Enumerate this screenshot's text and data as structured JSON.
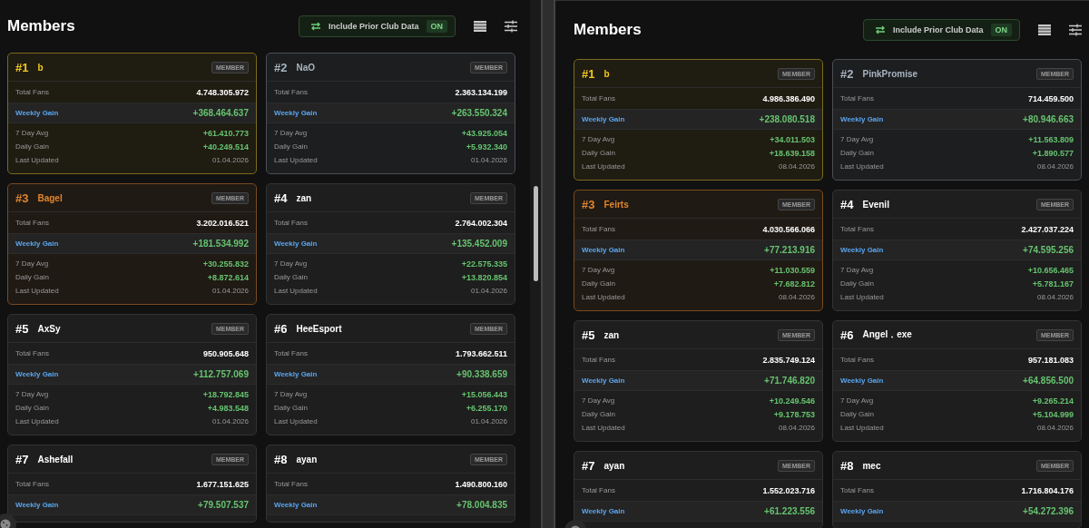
{
  "panes": [
    {
      "title": "Members",
      "toggle": {
        "label": "Include Prior Club Data",
        "state": "ON",
        "on": true
      },
      "cards": [
        {
          "rank": "#1",
          "name": "b",
          "kind": "gold",
          "badge": "MEMBER",
          "stats": [
            {
              "kind": "total",
              "label": "Total Fans",
              "value": "4.748.305.972"
            },
            {
              "kind": "weekly",
              "label": "Weekly Gain",
              "value": "+368.464.637"
            },
            {
              "kind": "gain",
              "label": "7 Day Avg",
              "value": "+61.410.773"
            },
            {
              "kind": "gain",
              "label": "Daily Gain",
              "value": "+40.249.514"
            },
            {
              "kind": "date",
              "label": "Last Updated",
              "value": "01.04.2026"
            }
          ]
        },
        {
          "rank": "#2",
          "name": "NaO",
          "kind": "silver",
          "badge": "MEMBER",
          "stats": [
            {
              "kind": "total",
              "label": "Total Fans",
              "value": "2.363.134.199"
            },
            {
              "kind": "weekly",
              "label": "Weekly Gain",
              "value": "+263.550.324"
            },
            {
              "kind": "gain",
              "label": "7 Day Avg",
              "value": "+43.925.054"
            },
            {
              "kind": "gain",
              "label": "Daily Gain",
              "value": "+5.932.340"
            },
            {
              "kind": "date",
              "label": "Last Updated",
              "value": "01.04.2026"
            }
          ]
        },
        {
          "rank": "#3",
          "name": "Bagel",
          "kind": "bronze",
          "badge": "MEMBER",
          "stats": [
            {
              "kind": "total",
              "label": "Total Fans",
              "value": "3.202.016.521"
            },
            {
              "kind": "weekly",
              "label": "Weekly Gain",
              "value": "+181.534.992"
            },
            {
              "kind": "gain",
              "label": "7 Day Avg",
              "value": "+30.255.832"
            },
            {
              "kind": "gain",
              "label": "Daily Gain",
              "value": "+8.872.614"
            },
            {
              "kind": "date",
              "label": "Last Updated",
              "value": "01.04.2026"
            }
          ]
        },
        {
          "rank": "#4",
          "name": "zan",
          "kind": "plain",
          "badge": "MEMBER",
          "stats": [
            {
              "kind": "total",
              "label": "Total Fans",
              "value": "2.764.002.304"
            },
            {
              "kind": "weekly",
              "label": "Weekly Gain",
              "value": "+135.452.009"
            },
            {
              "kind": "gain",
              "label": "7 Day Avg",
              "value": "+22.575.335"
            },
            {
              "kind": "gain",
              "label": "Daily Gain",
              "value": "+13.820.854"
            },
            {
              "kind": "date",
              "label": "Last Updated",
              "value": "01.04.2026"
            }
          ]
        },
        {
          "rank": "#5",
          "name": "AxSy",
          "kind": "plain",
          "badge": "MEMBER",
          "stats": [
            {
              "kind": "total",
              "label": "Total Fans",
              "value": "950.905.648"
            },
            {
              "kind": "weekly",
              "label": "Weekly Gain",
              "value": "+112.757.069"
            },
            {
              "kind": "gain",
              "label": "7 Day Avg",
              "value": "+18.792.845"
            },
            {
              "kind": "gain",
              "label": "Daily Gain",
              "value": "+4.983.548"
            },
            {
              "kind": "date",
              "label": "Last Updated",
              "value": "01.04.2026"
            }
          ]
        },
        {
          "rank": "#6",
          "name": "HeeEsport",
          "kind": "plain",
          "badge": "MEMBER",
          "stats": [
            {
              "kind": "total",
              "label": "Total Fans",
              "value": "1.793.662.511"
            },
            {
              "kind": "weekly",
              "label": "Weekly Gain",
              "value": "+90.338.659"
            },
            {
              "kind": "gain",
              "label": "7 Day Avg",
              "value": "+15.056.443"
            },
            {
              "kind": "gain",
              "label": "Daily Gain",
              "value": "+6.255.170"
            },
            {
              "kind": "date",
              "label": "Last Updated",
              "value": "01.04.2026"
            }
          ]
        },
        {
          "rank": "#7",
          "name": "Ashefall",
          "kind": "plain",
          "badge": "MEMBER",
          "stats": [
            {
              "kind": "total",
              "label": "Total Fans",
              "value": "1.677.151.625"
            },
            {
              "kind": "weekly",
              "label": "Weekly Gain",
              "value": "+79.507.537"
            }
          ]
        },
        {
          "rank": "#8",
          "name": "ayan",
          "kind": "plain",
          "badge": "MEMBER",
          "stats": [
            {
              "kind": "total",
              "label": "Total Fans",
              "value": "1.490.800.160"
            },
            {
              "kind": "weekly",
              "label": "Weekly Gain",
              "value": "+78.004.835"
            }
          ]
        }
      ]
    },
    {
      "title": "Members",
      "toggle": {
        "label": "Include Prior Club Data",
        "state": "ON",
        "on": true
      },
      "cards": [
        {
          "rank": "#1",
          "name": "b",
          "kind": "gold",
          "badge": "MEMBER",
          "stats": [
            {
              "kind": "total",
              "label": "Total Fans",
              "value": "4.986.386.490"
            },
            {
              "kind": "weekly",
              "label": "Weekly Gain",
              "value": "+238.080.518"
            },
            {
              "kind": "gain",
              "label": "7 Day Avg",
              "value": "+34.011.503"
            },
            {
              "kind": "gain",
              "label": "Daily Gain",
              "value": "+18.639.158"
            },
            {
              "kind": "date",
              "label": "Last Updated",
              "value": "08.04.2026"
            }
          ]
        },
        {
          "rank": "#2",
          "name": "PinkPromise",
          "kind": "silver",
          "badge": "MEMBER",
          "stats": [
            {
              "kind": "total",
              "label": "Total Fans",
              "value": "714.459.500"
            },
            {
              "kind": "weekly",
              "label": "Weekly Gain",
              "value": "+80.946.663"
            },
            {
              "kind": "gain",
              "label": "7 Day Avg",
              "value": "+11.563.809"
            },
            {
              "kind": "gain",
              "label": "Daily Gain",
              "value": "+1.890.577"
            },
            {
              "kind": "date",
              "label": "Last Updated",
              "value": "08.04.2026"
            }
          ]
        },
        {
          "rank": "#3",
          "name": "Feirts",
          "kind": "bronze",
          "badge": "MEMBER",
          "stats": [
            {
              "kind": "total",
              "label": "Total Fans",
              "value": "4.030.566.066"
            },
            {
              "kind": "weekly",
              "label": "Weekly Gain",
              "value": "+77.213.916"
            },
            {
              "kind": "gain",
              "label": "7 Day Avg",
              "value": "+11.030.559"
            },
            {
              "kind": "gain",
              "label": "Daily Gain",
              "value": "+7.682.812"
            },
            {
              "kind": "date",
              "label": "Last Updated",
              "value": "08.04.2026"
            }
          ]
        },
        {
          "rank": "#4",
          "name": "Evenil",
          "kind": "plain",
          "badge": "MEMBER",
          "stats": [
            {
              "kind": "total",
              "label": "Total Fans",
              "value": "2.427.037.224"
            },
            {
              "kind": "weekly",
              "label": "Weekly Gain",
              "value": "+74.595.256"
            },
            {
              "kind": "gain",
              "label": "7 Day Avg",
              "value": "+10.656.465"
            },
            {
              "kind": "gain",
              "label": "Daily Gain",
              "value": "+5.781.167"
            },
            {
              "kind": "date",
              "label": "Last Updated",
              "value": "08.04.2026"
            }
          ]
        },
        {
          "rank": "#5",
          "name": "zan",
          "kind": "plain",
          "badge": "MEMBER",
          "stats": [
            {
              "kind": "total",
              "label": "Total Fans",
              "value": "2.835.749.124"
            },
            {
              "kind": "weekly",
              "label": "Weekly Gain",
              "value": "+71.746.820"
            },
            {
              "kind": "gain",
              "label": "7 Day Avg",
              "value": "+10.249.546"
            },
            {
              "kind": "gain",
              "label": "Daily Gain",
              "value": "+9.178.753"
            },
            {
              "kind": "date",
              "label": "Last Updated",
              "value": "08.04.2026"
            }
          ]
        },
        {
          "rank": "#6",
          "name": "Angel．exe",
          "kind": "plain",
          "badge": "MEMBER",
          "stats": [
            {
              "kind": "total",
              "label": "Total Fans",
              "value": "957.181.083"
            },
            {
              "kind": "weekly",
              "label": "Weekly Gain",
              "value": "+64.856.500"
            },
            {
              "kind": "gain",
              "label": "7 Day Avg",
              "value": "+9.265.214"
            },
            {
              "kind": "gain",
              "label": "Daily Gain",
              "value": "+5.104.999"
            },
            {
              "kind": "date",
              "label": "Last Updated",
              "value": "08.04.2026"
            }
          ]
        },
        {
          "rank": "#7",
          "name": "ayan",
          "kind": "plain",
          "badge": "MEMBER",
          "stats": [
            {
              "kind": "total",
              "label": "Total Fans",
              "value": "1.552.023.716"
            },
            {
              "kind": "weekly",
              "label": "Weekly Gain",
              "value": "+61.223.556"
            }
          ]
        },
        {
          "rank": "#8",
          "name": "mec",
          "kind": "plain",
          "badge": "MEMBER",
          "stats": [
            {
              "kind": "total",
              "label": "Total Fans",
              "value": "1.716.804.176"
            },
            {
              "kind": "weekly",
              "label": "Weekly Gain",
              "value": "+54.272.396"
            }
          ]
        }
      ]
    }
  ]
}
